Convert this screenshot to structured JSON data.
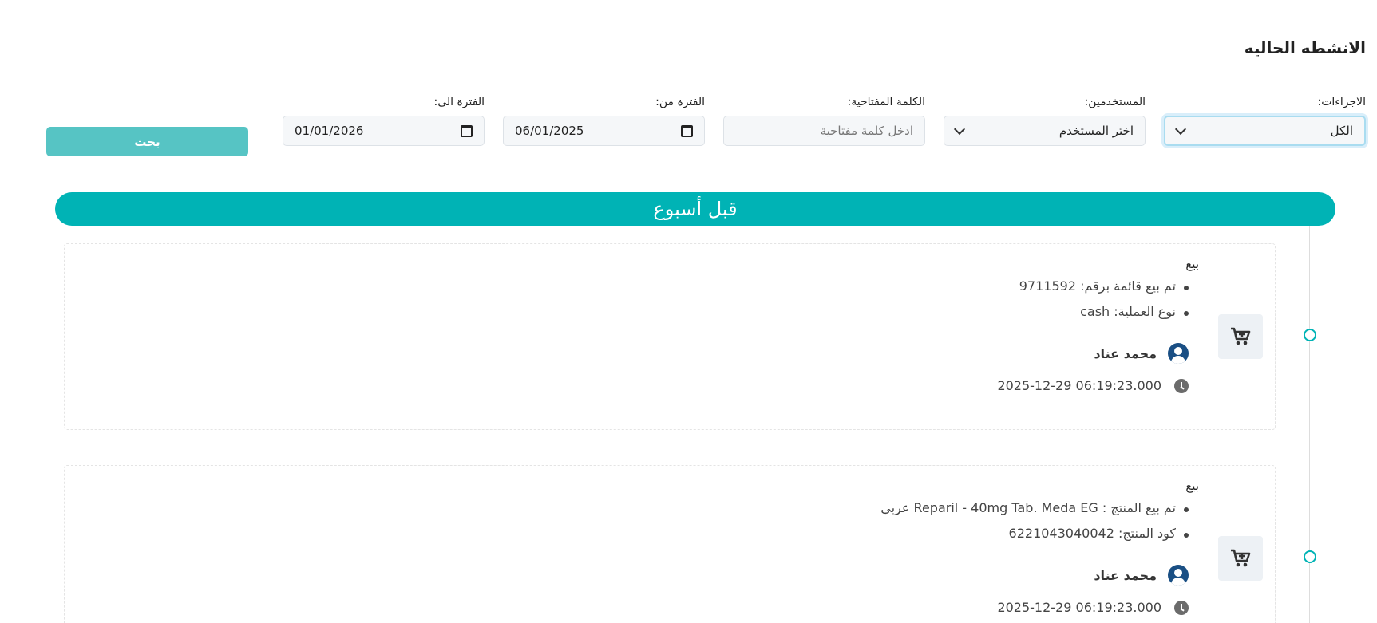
{
  "page": {
    "title": "الانشطه الحاليه"
  },
  "filters": {
    "actions": {
      "label": "الاجراءات:",
      "value": "الكل"
    },
    "users": {
      "label": "المستخدمين:",
      "value": "اختر المستخدم"
    },
    "keyword": {
      "label": "الكلمة المفتاحية:",
      "placeholder": "ادخل كلمة مفتاحية"
    },
    "date_from": {
      "label": "الفترة من:",
      "value": "06/01/2025"
    },
    "date_to": {
      "label": "الفترة الى:",
      "value": "01/01/2026"
    },
    "search_label": "بحث"
  },
  "period_label": "قبل أسبوع",
  "activities": [
    {
      "type": "بيع",
      "details": [
        "تم بيع قائمة برقم: 9711592",
        "نوع العملية: cash"
      ],
      "user": "محمد عناد",
      "time": "2025-12-29 06:19:23.000",
      "icon": "cart-plus-icon"
    },
    {
      "type": "بيع",
      "details": [
        "تم بيع المنتج : Reparil - 40mg Tab. Meda EG عربي",
        "كود المنتج: 6221043040042"
      ],
      "user": "محمد عناد",
      "time": "2025-12-29 06:19:23.000",
      "icon": "cart-plus-icon"
    }
  ],
  "colors": {
    "accent": "#00b3b5",
    "button": "#56c4c4",
    "avatar": "#1a4f84"
  }
}
